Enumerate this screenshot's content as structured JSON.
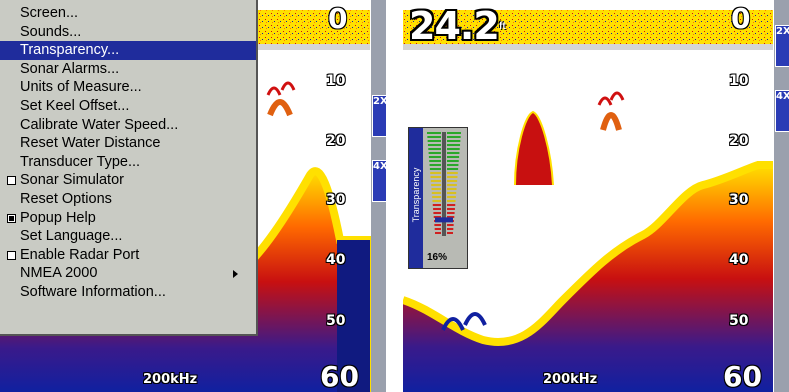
{
  "menu": {
    "items": [
      {
        "label": "Screen...",
        "type": "normal"
      },
      {
        "label": "Sounds...",
        "type": "normal"
      },
      {
        "label": "Transparency...",
        "type": "selected"
      },
      {
        "label": "Sonar Alarms...",
        "type": "normal"
      },
      {
        "label": "Units of Measure...",
        "type": "normal"
      },
      {
        "label": "Set Keel Offset...",
        "type": "normal"
      },
      {
        "label": "Calibrate Water Speed...",
        "type": "normal"
      },
      {
        "label": "Reset Water Distance",
        "type": "normal"
      },
      {
        "label": "Transducer Type...",
        "type": "normal"
      },
      {
        "label": "Sonar Simulator",
        "type": "checkbox",
        "checked": false
      },
      {
        "label": "Reset Options",
        "type": "normal"
      },
      {
        "label": "Popup Help",
        "type": "checkbox",
        "checked": true
      },
      {
        "label": "Set Language...",
        "type": "normal"
      },
      {
        "label": "Enable Radar Port",
        "type": "checkbox",
        "checked": false
      },
      {
        "label": "NMEA 2000",
        "type": "submenu"
      },
      {
        "label": "Software Information...",
        "type": "normal"
      }
    ]
  },
  "left_screen": {
    "depth_scale": [
      "0",
      "10",
      "20",
      "30",
      "40",
      "50",
      "60"
    ],
    "frequency": "200kHz",
    "zoom_buttons": [
      "2X",
      "4X"
    ]
  },
  "right_screen": {
    "depth_reading": "24.2",
    "depth_unit": "ft",
    "depth_scale": [
      "0",
      "10",
      "20",
      "30",
      "40",
      "50",
      "60"
    ],
    "frequency": "200kHz",
    "zoom_buttons": [
      "2X",
      "4X"
    ],
    "transparency": {
      "label": "Transparency",
      "value": "16%",
      "level": 0.16
    }
  },
  "colors": {
    "menu_bg": "#c9cbc4",
    "menu_selected": "#1f2c9c",
    "sonar_yellow": "#ffe000",
    "sonar_red": "#e01010",
    "sonar_blue": "#1020a0",
    "zoom_bar": "#9aa0ad"
  }
}
